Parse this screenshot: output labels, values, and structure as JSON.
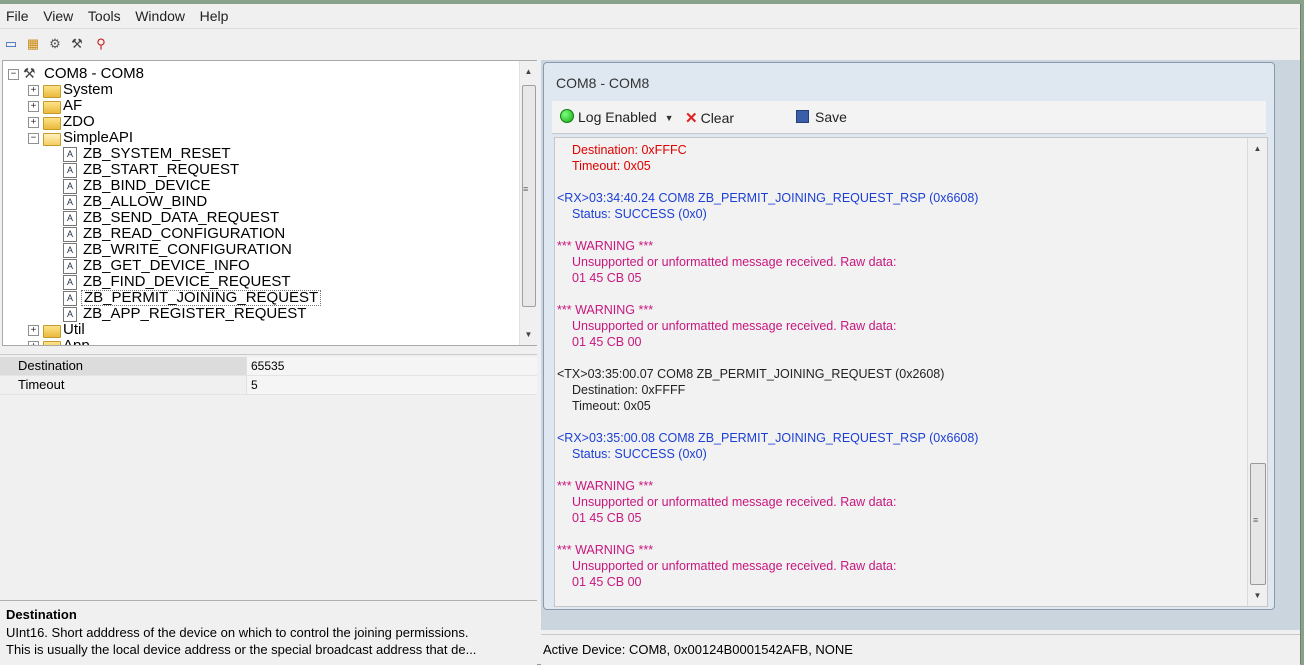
{
  "menu": [
    "File",
    "View",
    "Tools",
    "Window",
    "Help"
  ],
  "toolbar_icons": [
    "open-icon",
    "device-icon",
    "settings-icon",
    "tools-icon",
    "search-icon"
  ],
  "tree": {
    "root": "COM8 - COM8",
    "folders": [
      "System",
      "AF",
      "ZDO",
      "SimpleAPI"
    ],
    "simpleapi_items": [
      "ZB_SYSTEM_RESET",
      "ZB_START_REQUEST",
      "ZB_BIND_DEVICE",
      "ZB_ALLOW_BIND",
      "ZB_SEND_DATA_REQUEST",
      "ZB_READ_CONFIGURATION",
      "ZB_WRITE_CONFIGURATION",
      "ZB_GET_DEVICE_INFO",
      "ZB_FIND_DEVICE_REQUEST",
      "ZB_PERMIT_JOINING_REQUEST",
      "ZB_APP_REGISTER_REQUEST"
    ],
    "after_folders": [
      "Util",
      "App"
    ]
  },
  "properties": [
    {
      "name": "Destination",
      "value": "65535"
    },
    {
      "name": "Timeout",
      "value": "5"
    }
  ],
  "description": {
    "title": "Destination",
    "line1": "UInt16.  Short adddress of the device on which to control the joining permissions.",
    "line2": "This is usually the local device address or the special broadcast address that de..."
  },
  "log": {
    "title": "COM8 - COM8",
    "log_enabled_label": "Log Enabled",
    "clear_label": "Clear",
    "save_label": "Save",
    "lines": [
      {
        "text": "Destination: 0xFFFC",
        "color": "red",
        "indent": true
      },
      {
        "text": "Timeout: 0x05",
        "color": "red",
        "indent": true
      },
      {
        "text": "<RX>03:34:40.24 COM8 ZB_PERMIT_JOINING_REQUEST_RSP (0x6608)",
        "color": "blue",
        "indent": false
      },
      {
        "text": "Status: SUCCESS (0x0)",
        "color": "blue",
        "indent": true
      },
      {
        "text": "*** WARNING ***",
        "color": "mag",
        "indent": false
      },
      {
        "text": "Unsupported or unformatted message received.  Raw data:",
        "color": "mag",
        "indent": true
      },
      {
        "text": "01 45 CB 05",
        "color": "mag",
        "indent": true
      },
      {
        "text": "*** WARNING ***",
        "color": "mag",
        "indent": false
      },
      {
        "text": "Unsupported or unformatted message received.  Raw data:",
        "color": "mag",
        "indent": true
      },
      {
        "text": "01 45 CB 00",
        "color": "mag",
        "indent": true
      },
      {
        "text": "<TX>03:35:00.07 COM8 ZB_PERMIT_JOINING_REQUEST (0x2608)",
        "color": "black",
        "indent": false
      },
      {
        "text": "Destination: 0xFFFF",
        "color": "black",
        "indent": true
      },
      {
        "text": "Timeout: 0x05",
        "color": "black",
        "indent": true
      },
      {
        "text": "<RX>03:35:00.08 COM8 ZB_PERMIT_JOINING_REQUEST_RSP (0x6608)",
        "color": "blue",
        "indent": false
      },
      {
        "text": "Status: SUCCESS (0x0)",
        "color": "blue",
        "indent": true
      },
      {
        "text": "*** WARNING ***",
        "color": "mag",
        "indent": false
      },
      {
        "text": "Unsupported or unformatted message received.  Raw data:",
        "color": "mag",
        "indent": true
      },
      {
        "text": "01 45 CB 05",
        "color": "mag",
        "indent": true
      },
      {
        "text": "*** WARNING ***",
        "color": "mag",
        "indent": false
      },
      {
        "text": "Unsupported or unformatted message received.  Raw data:",
        "color": "mag",
        "indent": true
      },
      {
        "text": "01 45 CB 00",
        "color": "mag",
        "indent": true
      }
    ]
  },
  "status": "Active Device: COM8, 0x00124B0001542AFB, NONE",
  "colors": {
    "log_red": "#e00000",
    "log_blue": "#1c3fd6",
    "log_magenta": "#c8177f",
    "log_black": "#222222"
  }
}
